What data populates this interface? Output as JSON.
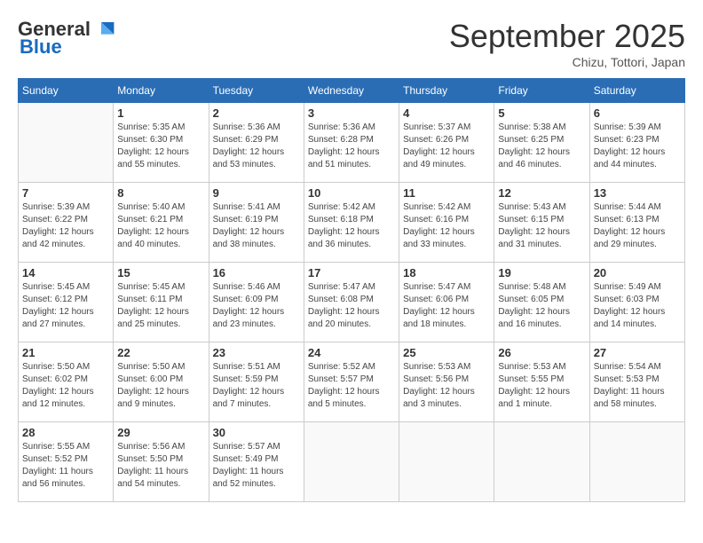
{
  "header": {
    "logo_general": "General",
    "logo_blue": "Blue",
    "month_title": "September 2025",
    "subtitle": "Chizu, Tottori, Japan"
  },
  "days_of_week": [
    "Sunday",
    "Monday",
    "Tuesday",
    "Wednesday",
    "Thursday",
    "Friday",
    "Saturday"
  ],
  "weeks": [
    [
      {
        "day": "",
        "info": ""
      },
      {
        "day": "1",
        "info": "Sunrise: 5:35 AM\nSunset: 6:30 PM\nDaylight: 12 hours\nand 55 minutes."
      },
      {
        "day": "2",
        "info": "Sunrise: 5:36 AM\nSunset: 6:29 PM\nDaylight: 12 hours\nand 53 minutes."
      },
      {
        "day": "3",
        "info": "Sunrise: 5:36 AM\nSunset: 6:28 PM\nDaylight: 12 hours\nand 51 minutes."
      },
      {
        "day": "4",
        "info": "Sunrise: 5:37 AM\nSunset: 6:26 PM\nDaylight: 12 hours\nand 49 minutes."
      },
      {
        "day": "5",
        "info": "Sunrise: 5:38 AM\nSunset: 6:25 PM\nDaylight: 12 hours\nand 46 minutes."
      },
      {
        "day": "6",
        "info": "Sunrise: 5:39 AM\nSunset: 6:23 PM\nDaylight: 12 hours\nand 44 minutes."
      }
    ],
    [
      {
        "day": "7",
        "info": "Sunrise: 5:39 AM\nSunset: 6:22 PM\nDaylight: 12 hours\nand 42 minutes."
      },
      {
        "day": "8",
        "info": "Sunrise: 5:40 AM\nSunset: 6:21 PM\nDaylight: 12 hours\nand 40 minutes."
      },
      {
        "day": "9",
        "info": "Sunrise: 5:41 AM\nSunset: 6:19 PM\nDaylight: 12 hours\nand 38 minutes."
      },
      {
        "day": "10",
        "info": "Sunrise: 5:42 AM\nSunset: 6:18 PM\nDaylight: 12 hours\nand 36 minutes."
      },
      {
        "day": "11",
        "info": "Sunrise: 5:42 AM\nSunset: 6:16 PM\nDaylight: 12 hours\nand 33 minutes."
      },
      {
        "day": "12",
        "info": "Sunrise: 5:43 AM\nSunset: 6:15 PM\nDaylight: 12 hours\nand 31 minutes."
      },
      {
        "day": "13",
        "info": "Sunrise: 5:44 AM\nSunset: 6:13 PM\nDaylight: 12 hours\nand 29 minutes."
      }
    ],
    [
      {
        "day": "14",
        "info": "Sunrise: 5:45 AM\nSunset: 6:12 PM\nDaylight: 12 hours\nand 27 minutes."
      },
      {
        "day": "15",
        "info": "Sunrise: 5:45 AM\nSunset: 6:11 PM\nDaylight: 12 hours\nand 25 minutes."
      },
      {
        "day": "16",
        "info": "Sunrise: 5:46 AM\nSunset: 6:09 PM\nDaylight: 12 hours\nand 23 minutes."
      },
      {
        "day": "17",
        "info": "Sunrise: 5:47 AM\nSunset: 6:08 PM\nDaylight: 12 hours\nand 20 minutes."
      },
      {
        "day": "18",
        "info": "Sunrise: 5:47 AM\nSunset: 6:06 PM\nDaylight: 12 hours\nand 18 minutes."
      },
      {
        "day": "19",
        "info": "Sunrise: 5:48 AM\nSunset: 6:05 PM\nDaylight: 12 hours\nand 16 minutes."
      },
      {
        "day": "20",
        "info": "Sunrise: 5:49 AM\nSunset: 6:03 PM\nDaylight: 12 hours\nand 14 minutes."
      }
    ],
    [
      {
        "day": "21",
        "info": "Sunrise: 5:50 AM\nSunset: 6:02 PM\nDaylight: 12 hours\nand 12 minutes."
      },
      {
        "day": "22",
        "info": "Sunrise: 5:50 AM\nSunset: 6:00 PM\nDaylight: 12 hours\nand 9 minutes."
      },
      {
        "day": "23",
        "info": "Sunrise: 5:51 AM\nSunset: 5:59 PM\nDaylight: 12 hours\nand 7 minutes."
      },
      {
        "day": "24",
        "info": "Sunrise: 5:52 AM\nSunset: 5:57 PM\nDaylight: 12 hours\nand 5 minutes."
      },
      {
        "day": "25",
        "info": "Sunrise: 5:53 AM\nSunset: 5:56 PM\nDaylight: 12 hours\nand 3 minutes."
      },
      {
        "day": "26",
        "info": "Sunrise: 5:53 AM\nSunset: 5:55 PM\nDaylight: 12 hours\nand 1 minute."
      },
      {
        "day": "27",
        "info": "Sunrise: 5:54 AM\nSunset: 5:53 PM\nDaylight: 11 hours\nand 58 minutes."
      }
    ],
    [
      {
        "day": "28",
        "info": "Sunrise: 5:55 AM\nSunset: 5:52 PM\nDaylight: 11 hours\nand 56 minutes."
      },
      {
        "day": "29",
        "info": "Sunrise: 5:56 AM\nSunset: 5:50 PM\nDaylight: 11 hours\nand 54 minutes."
      },
      {
        "day": "30",
        "info": "Sunrise: 5:57 AM\nSunset: 5:49 PM\nDaylight: 11 hours\nand 52 minutes."
      },
      {
        "day": "",
        "info": ""
      },
      {
        "day": "",
        "info": ""
      },
      {
        "day": "",
        "info": ""
      },
      {
        "day": "",
        "info": ""
      }
    ]
  ]
}
